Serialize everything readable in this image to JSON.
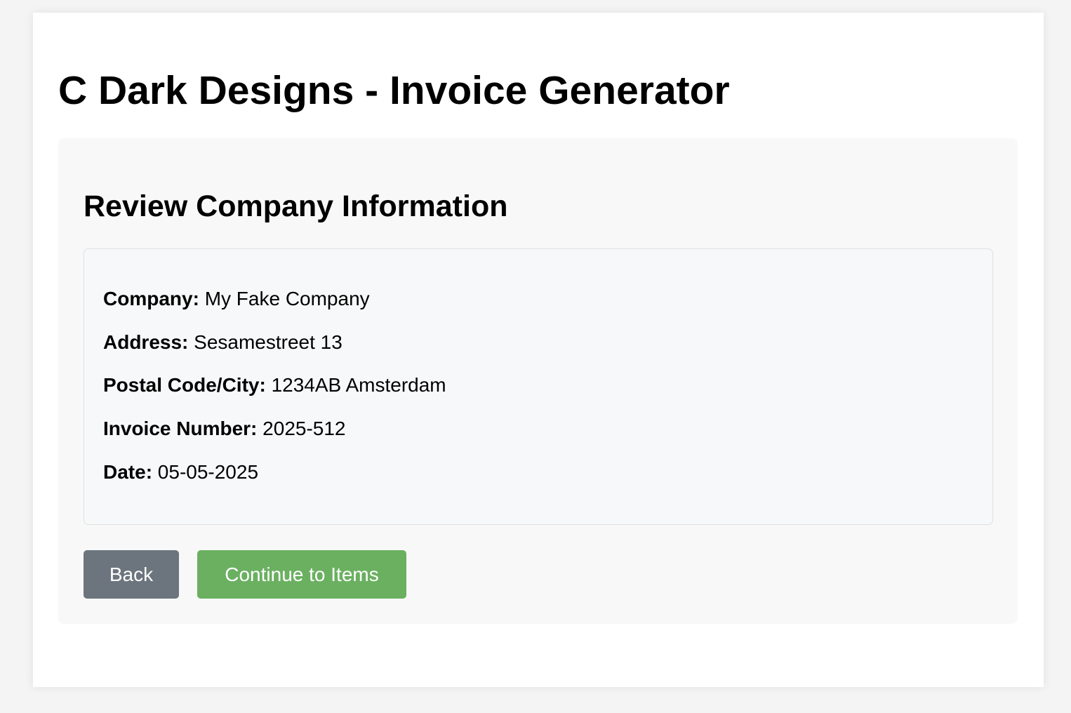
{
  "header": {
    "title": "C Dark Designs - Invoice Generator"
  },
  "review": {
    "heading": "Review Company Information",
    "fields": [
      {
        "label": "Company:",
        "value": "My Fake Company"
      },
      {
        "label": "Address:",
        "value": "Sesamestreet 13"
      },
      {
        "label": "Postal Code/City:",
        "value": "1234AB Amsterdam"
      },
      {
        "label": "Invoice Number:",
        "value": "2025-512"
      },
      {
        "label": "Date:",
        "value": "05-05-2025"
      }
    ]
  },
  "actions": {
    "back_label": "Back",
    "continue_label": "Continue to Items"
  },
  "colors": {
    "back_button": "#6c757d",
    "continue_button": "#6ab060",
    "panel_background": "#f8f8f8",
    "page_background": "#f4f4f4"
  }
}
